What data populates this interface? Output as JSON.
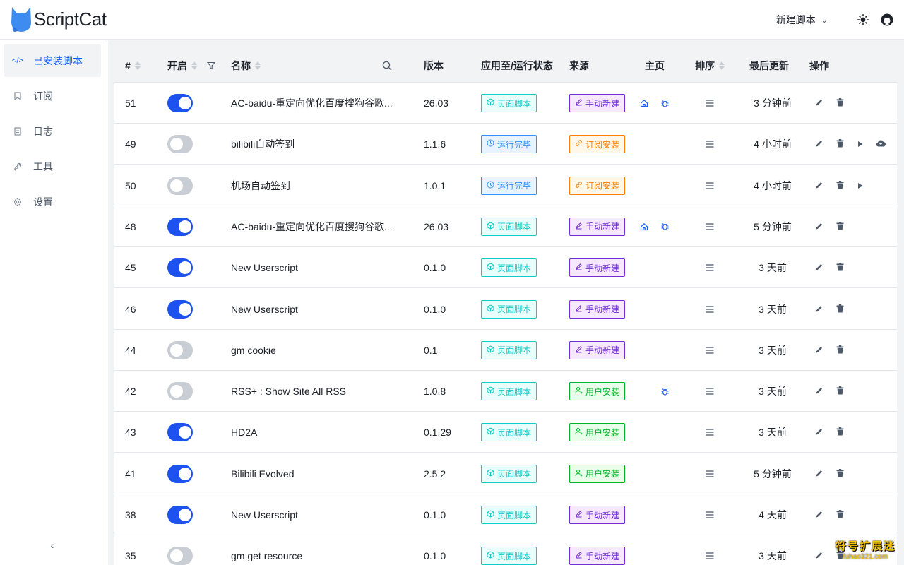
{
  "app": {
    "title": "ScriptCat"
  },
  "header": {
    "new_script_label": "新建脚本"
  },
  "sidebar": {
    "items": [
      {
        "label": "已安装脚本",
        "icon": "code-icon",
        "active": true
      },
      {
        "label": "订阅",
        "icon": "bookmark-icon",
        "active": false
      },
      {
        "label": "日志",
        "icon": "file-icon",
        "active": false
      },
      {
        "label": "工具",
        "icon": "wrench-icon",
        "active": false
      },
      {
        "label": "设置",
        "icon": "gear-icon",
        "active": false
      }
    ]
  },
  "table": {
    "columns": {
      "id": "#",
      "enabled": "开启",
      "name": "名称",
      "version": "版本",
      "apply": "应用至/运行状态",
      "source": "来源",
      "homepage": "主页",
      "order": "排序",
      "updated": "最后更新",
      "actions": "操作"
    },
    "tag_labels": {
      "page": "页面脚本",
      "done": "运行完毕",
      "manual": "手动新建",
      "sub": "订阅安装",
      "user": "用户安装"
    },
    "rows": [
      {
        "id": "51",
        "enabled": true,
        "name": "AC-baidu-重定向优化百度搜狗谷歌...",
        "version": "26.03",
        "apply": "page",
        "source": "manual",
        "home": true,
        "bug": true,
        "updated": "3 分钟前",
        "run": false,
        "cloud": false
      },
      {
        "id": "49",
        "enabled": false,
        "name": "bilibili自动签到",
        "version": "1.1.6",
        "apply": "done",
        "source": "sub",
        "home": false,
        "bug": false,
        "updated": "4 小时前",
        "run": true,
        "cloud": true
      },
      {
        "id": "50",
        "enabled": false,
        "name": "机场自动签到",
        "version": "1.0.1",
        "apply": "done",
        "source": "sub",
        "home": false,
        "bug": false,
        "updated": "4 小时前",
        "run": true,
        "cloud": false
      },
      {
        "id": "48",
        "enabled": true,
        "name": "AC-baidu-重定向优化百度搜狗谷歌...",
        "version": "26.03",
        "apply": "page",
        "source": "manual",
        "home": true,
        "bug": true,
        "updated": "5 分钟前",
        "run": false,
        "cloud": false
      },
      {
        "id": "45",
        "enabled": true,
        "name": "New Userscript",
        "version": "0.1.0",
        "apply": "page",
        "source": "manual",
        "home": false,
        "bug": false,
        "updated": "3 天前",
        "run": false,
        "cloud": false
      },
      {
        "id": "46",
        "enabled": true,
        "name": "New Userscript",
        "version": "0.1.0",
        "apply": "page",
        "source": "manual",
        "home": false,
        "bug": false,
        "updated": "3 天前",
        "run": false,
        "cloud": false
      },
      {
        "id": "44",
        "enabled": false,
        "name": "gm cookie",
        "version": "0.1",
        "apply": "page",
        "source": "manual",
        "home": false,
        "bug": false,
        "updated": "3 天前",
        "run": false,
        "cloud": false
      },
      {
        "id": "42",
        "enabled": false,
        "name": "RSS+ : Show Site All RSS",
        "version": "1.0.8",
        "apply": "page",
        "source": "user",
        "home": false,
        "bug": true,
        "updated": "3 天前",
        "run": false,
        "cloud": false
      },
      {
        "id": "43",
        "enabled": true,
        "name": "HD2A",
        "version": "0.1.29",
        "apply": "page",
        "source": "user",
        "home": false,
        "bug": false,
        "updated": "3 天前",
        "run": false,
        "cloud": false
      },
      {
        "id": "41",
        "enabled": true,
        "name": "Bilibili Evolved",
        "version": "2.5.2",
        "apply": "page",
        "source": "user",
        "home": false,
        "bug": false,
        "updated": "5 分钟前",
        "run": false,
        "cloud": false
      },
      {
        "id": "38",
        "enabled": true,
        "name": "New Userscript",
        "version": "0.1.0",
        "apply": "page",
        "source": "manual",
        "home": false,
        "bug": false,
        "updated": "4 天前",
        "run": false,
        "cloud": false
      },
      {
        "id": "35",
        "enabled": false,
        "name": "gm get resource",
        "version": "0.1.0",
        "apply": "page",
        "source": "manual",
        "home": false,
        "bug": false,
        "updated": "3 天前",
        "run": false,
        "cloud": false
      }
    ]
  },
  "watermark": {
    "line1": "符号扩展迷",
    "line2": "fuhao321.com"
  },
  "colors": {
    "accent": "#165dff",
    "switch_on": "#1d52ef",
    "switch_off": "#c9cdd4"
  }
}
